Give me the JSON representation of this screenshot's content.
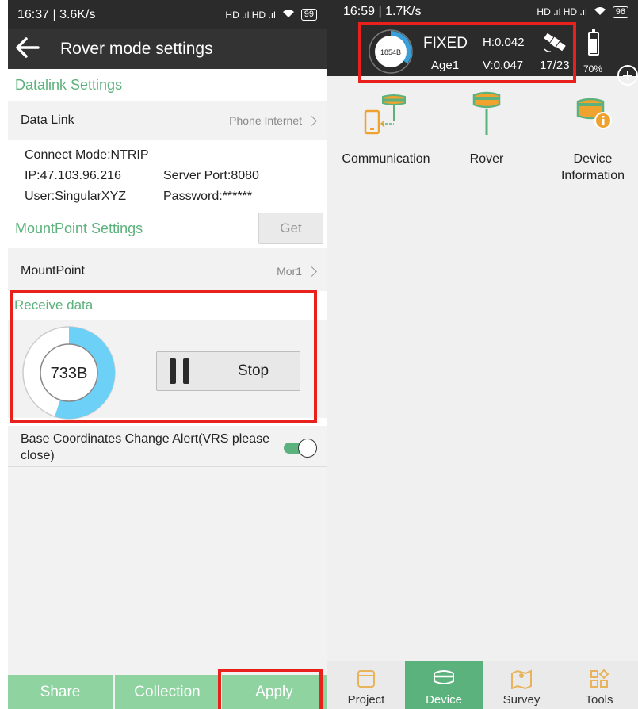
{
  "left": {
    "status": {
      "time": "16:37 | 3.6K/s",
      "signal": "HD .ıl HD .ıl",
      "battery": "99"
    },
    "appbar": {
      "title": "Rover mode settings"
    },
    "datalink": {
      "section_title": "Datalink Settings",
      "label": "Data Link",
      "value": "Phone Internet",
      "connect_mode": "Connect Mode:NTRIP",
      "ip": "IP:47.103.96.216",
      "server_port": "Server Port:8080",
      "user": "User:SingularXYZ",
      "password": "Password:******"
    },
    "mountpoint": {
      "section_title": "MountPoint Settings",
      "get_label": "Get",
      "label": "MountPoint",
      "value": "Mor1"
    },
    "receive": {
      "title": "Receive data",
      "amount": "733B",
      "fill": 0.55,
      "stop_label": "Stop"
    },
    "alert": {
      "label": "Base Coordinates Change Alert(VRS please close)",
      "enabled": true
    },
    "buttons": {
      "share": "Share",
      "collection": "Collection",
      "apply": "Apply"
    }
  },
  "right": {
    "status": {
      "time": "16:59 | 1.7K/s",
      "signal": "HD .ıl HD .ıl",
      "battery": "96"
    },
    "header": {
      "data_amount": "1854B",
      "fill": 0.35,
      "solution": "FIXED",
      "age": "Age1",
      "h": "H:0.042",
      "v": "V:0.047",
      "satellites": "17/23",
      "battery_pct": "70%"
    },
    "tiles": [
      {
        "label": "Communication"
      },
      {
        "label": "Rover"
      },
      {
        "label": "Device Information"
      }
    ],
    "tabs": [
      {
        "label": "Project"
      },
      {
        "label": "Device"
      },
      {
        "label": "Survey"
      },
      {
        "label": "Tools"
      }
    ]
  },
  "colors": {
    "accent": "#5cb27c",
    "donut": "#6dd0f7",
    "highlight": "#e8211c",
    "button": "#8fd3a0"
  }
}
